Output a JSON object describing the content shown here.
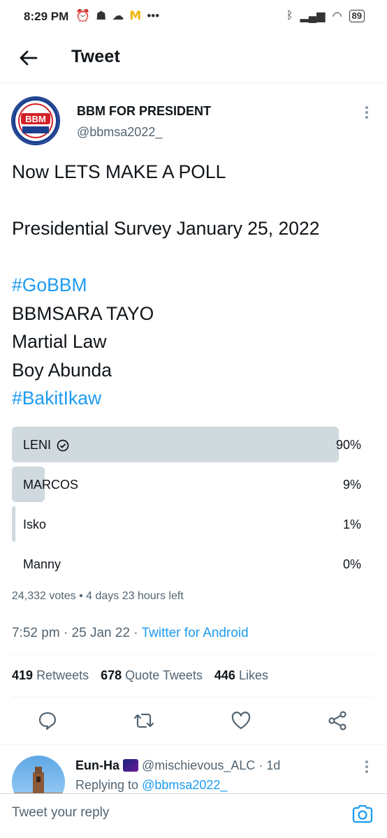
{
  "status_bar": {
    "time": "8:29 PM",
    "battery": "89"
  },
  "header": {
    "title": "Tweet"
  },
  "author": {
    "name": "BBM FOR PRESIDENT",
    "handle": "@bbmsa2022_",
    "avatar_text": "BBM"
  },
  "tweet": {
    "lines": [
      {
        "text": "Now LETS MAKE A POLL",
        "type": "text"
      },
      {
        "text": "",
        "type": "blank"
      },
      {
        "text": "Presidential Survey January 25, 2022",
        "type": "text"
      },
      {
        "text": "",
        "type": "blank"
      },
      {
        "text": "#GoBBM",
        "type": "hashtag"
      },
      {
        "text": "BBMSARA TAYO",
        "type": "text"
      },
      {
        "text": "Martial Law",
        "type": "text"
      },
      {
        "text": "Boy Abunda",
        "type": "text"
      },
      {
        "text": "#BakitIkaw",
        "type": "hashtag"
      }
    ]
  },
  "poll": {
    "options": [
      {
        "label": "LENI",
        "percent_text": "90%",
        "fraction": 0.93,
        "winner": true
      },
      {
        "label": "MARCOS",
        "percent_text": "9%",
        "fraction": 0.093,
        "winner": false
      },
      {
        "label": "Isko",
        "percent_text": "1%",
        "fraction": 0.01,
        "winner": false
      },
      {
        "label": "Manny",
        "percent_text": "0%",
        "fraction": 0.0,
        "winner": false
      }
    ],
    "meta": "24,332 votes • 4 days 23 hours left"
  },
  "timestamp": {
    "time": "7:52 pm",
    "date": "25 Jan 22",
    "source": "Twitter for Android"
  },
  "stats": {
    "retweets_count": "419",
    "retweets_label": "Retweets",
    "quotes_count": "678",
    "quotes_label": "Quote Tweets",
    "likes_count": "446",
    "likes_label": "Likes"
  },
  "reply_preview": {
    "name": "Eun-Ha",
    "handle": "@mischievous_ALC",
    "age": "1d",
    "replying_prefix": "Replying to",
    "replying_to": "@bbmsa2022_"
  },
  "composer": {
    "placeholder": "Tweet your reply"
  },
  "colors": {
    "accent": "#1d9bf0",
    "poll_bar": "#cfd9de",
    "muted": "#536471"
  }
}
